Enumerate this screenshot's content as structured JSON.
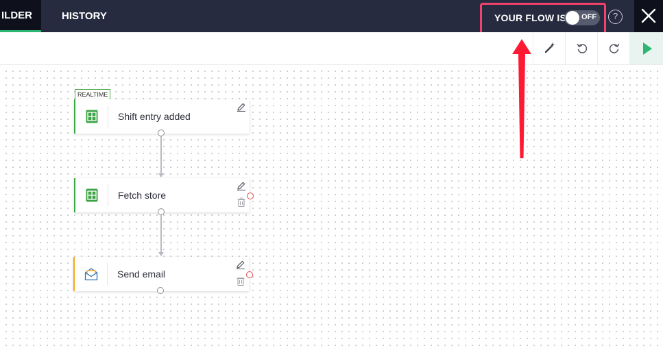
{
  "header": {
    "tabs": [
      {
        "label": "ILDER",
        "active": true
      },
      {
        "label": "HISTORY",
        "active": false
      }
    ],
    "flow_status": {
      "label": "YOUR FLOW IS",
      "toggle_text": "OFF",
      "enabled": false
    },
    "help_label": "?"
  },
  "toolbar": {
    "icons": [
      "magic-wand-icon",
      "undo-icon",
      "redo-icon",
      "play-icon"
    ]
  },
  "workflow": {
    "badge": "REALTIME",
    "nodes": [
      {
        "label": "Shift entry added",
        "icon": "table-icon",
        "accent": "#3aa844"
      },
      {
        "label": "Fetch store",
        "icon": "table-icon",
        "accent": "#3aa844"
      },
      {
        "label": "Send email",
        "icon": "envelope-icon",
        "accent": "#f4a81c"
      }
    ]
  },
  "colors": {
    "topbar": "#262b40",
    "highlight": "#f0426a",
    "annotation_arrow": "#ff1a33",
    "run": "#2bb673"
  }
}
